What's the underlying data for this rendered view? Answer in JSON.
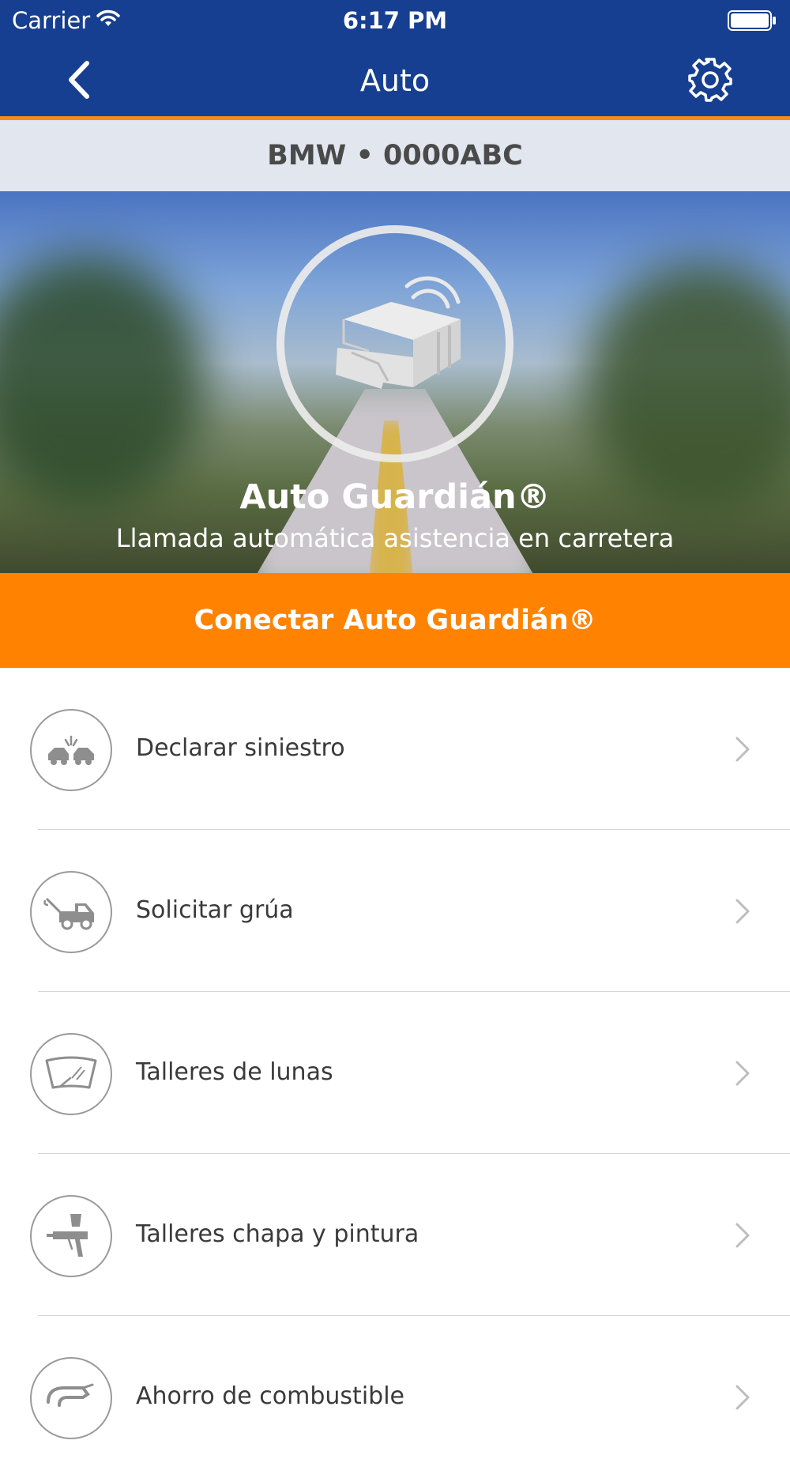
{
  "status_bar": {
    "carrier": "Carrier",
    "time": "6:17 PM"
  },
  "nav": {
    "title": "Auto"
  },
  "vehicle": {
    "label": "BMW • 0000ABC"
  },
  "hero": {
    "title": "Auto Guardián®",
    "subtitle": "Llamada automática asistencia en carretera"
  },
  "connect_button": {
    "label": "Conectar Auto Guardián®"
  },
  "menu": {
    "items": [
      {
        "label": "Declarar siniestro",
        "icon": "car-crash-icon"
      },
      {
        "label": "Solicitar grúa",
        "icon": "tow-truck-icon"
      },
      {
        "label": "Talleres de lunas",
        "icon": "windshield-icon"
      },
      {
        "label": "Talleres chapa y pintura",
        "icon": "spray-gun-icon"
      },
      {
        "label": "Ahorro de combustible",
        "icon": "fuel-nozzle-icon"
      }
    ]
  },
  "colors": {
    "header": "#173f91",
    "accent_orange": "#ff8300",
    "header_underline": "#f7891f",
    "vehicle_bar": "#e1e6ef"
  }
}
